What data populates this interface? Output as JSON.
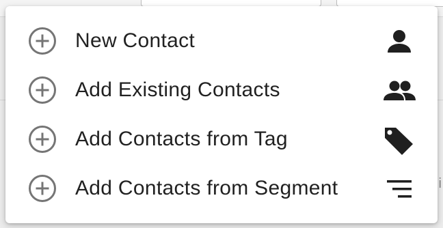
{
  "menu": {
    "items": [
      {
        "label": "New Contact",
        "leading_icon": "add-circle-outline-icon",
        "trailing_icon": "person-icon"
      },
      {
        "label": "Add Existing Contacts",
        "leading_icon": "add-circle-outline-icon",
        "trailing_icon": "people-icon"
      },
      {
        "label": "Add Contacts from Tag",
        "leading_icon": "add-circle-outline-icon",
        "trailing_icon": "tag-icon"
      },
      {
        "label": "Add Contacts from Segment",
        "leading_icon": "add-circle-outline-icon",
        "trailing_icon": "segment-list-icon"
      }
    ]
  },
  "colors": {
    "text": "#212121",
    "icon_outline": "#757575",
    "icon_fill": "#1f1f1f",
    "menu_background": "#ffffff"
  }
}
